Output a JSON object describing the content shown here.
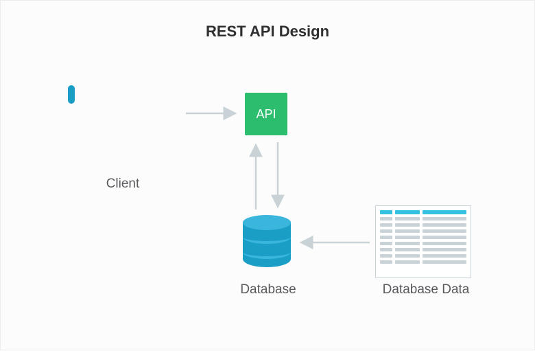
{
  "title": "REST API Design",
  "nodes": {
    "client": {
      "label": "Client"
    },
    "api": {
      "label": "API"
    },
    "database": {
      "label": "Database"
    },
    "database_data": {
      "label": "Database Data"
    }
  },
  "edges": [
    {
      "from": "client",
      "to": "api",
      "direction": "right"
    },
    {
      "from": "api",
      "to": "database",
      "direction": "down"
    },
    {
      "from": "database",
      "to": "api",
      "direction": "up"
    },
    {
      "from": "database_data",
      "to": "database",
      "direction": "left"
    }
  ],
  "colors": {
    "accent_blue": "#1b9ec6",
    "accent_green": "#2dbd6e",
    "arrow_gray": "#c9d2d6",
    "text": "#5a5a5e"
  }
}
